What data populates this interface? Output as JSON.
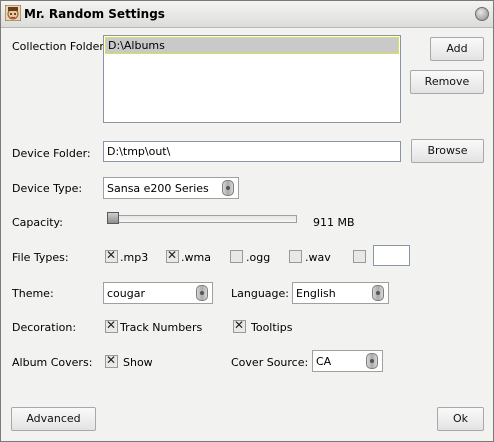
{
  "window": {
    "title": "Mr. Random Settings"
  },
  "collection": {
    "label": "Collection Folder:",
    "folders": [
      "D:\\Albums"
    ],
    "add_label": "Add",
    "remove_label": "Remove"
  },
  "device_folder": {
    "label": "Device Folder:",
    "value": "D:\\tmp\\out\\",
    "browse_label": "Browse"
  },
  "device_type": {
    "label": "Device Type:",
    "value": "Sansa e200 Series"
  },
  "capacity": {
    "label": "Capacity:",
    "value_text": "911 MB",
    "level": 0.0
  },
  "file_types": {
    "label": "File Types:",
    "items": [
      {
        "label": ".mp3",
        "checked": true
      },
      {
        "label": ".wma",
        "checked": true
      },
      {
        "label": ".ogg",
        "checked": false
      },
      {
        "label": ".wav",
        "checked": false
      },
      {
        "label": "",
        "checked": false
      }
    ],
    "custom_value": ""
  },
  "theme": {
    "label": "Theme:",
    "value": "cougar"
  },
  "language": {
    "label": "Language:",
    "value": "English"
  },
  "decoration": {
    "label": "Decoration:",
    "track_numbers": {
      "label": "Track Numbers",
      "checked": true
    },
    "tooltips": {
      "label": "Tooltips",
      "checked": true
    }
  },
  "album_covers": {
    "label": "Album Covers:",
    "show": {
      "label": "Show",
      "checked": true
    }
  },
  "cover_source": {
    "label": "Cover Source:",
    "value": "CA"
  },
  "footer": {
    "advanced_label": "Advanced",
    "ok_label": "Ok"
  }
}
